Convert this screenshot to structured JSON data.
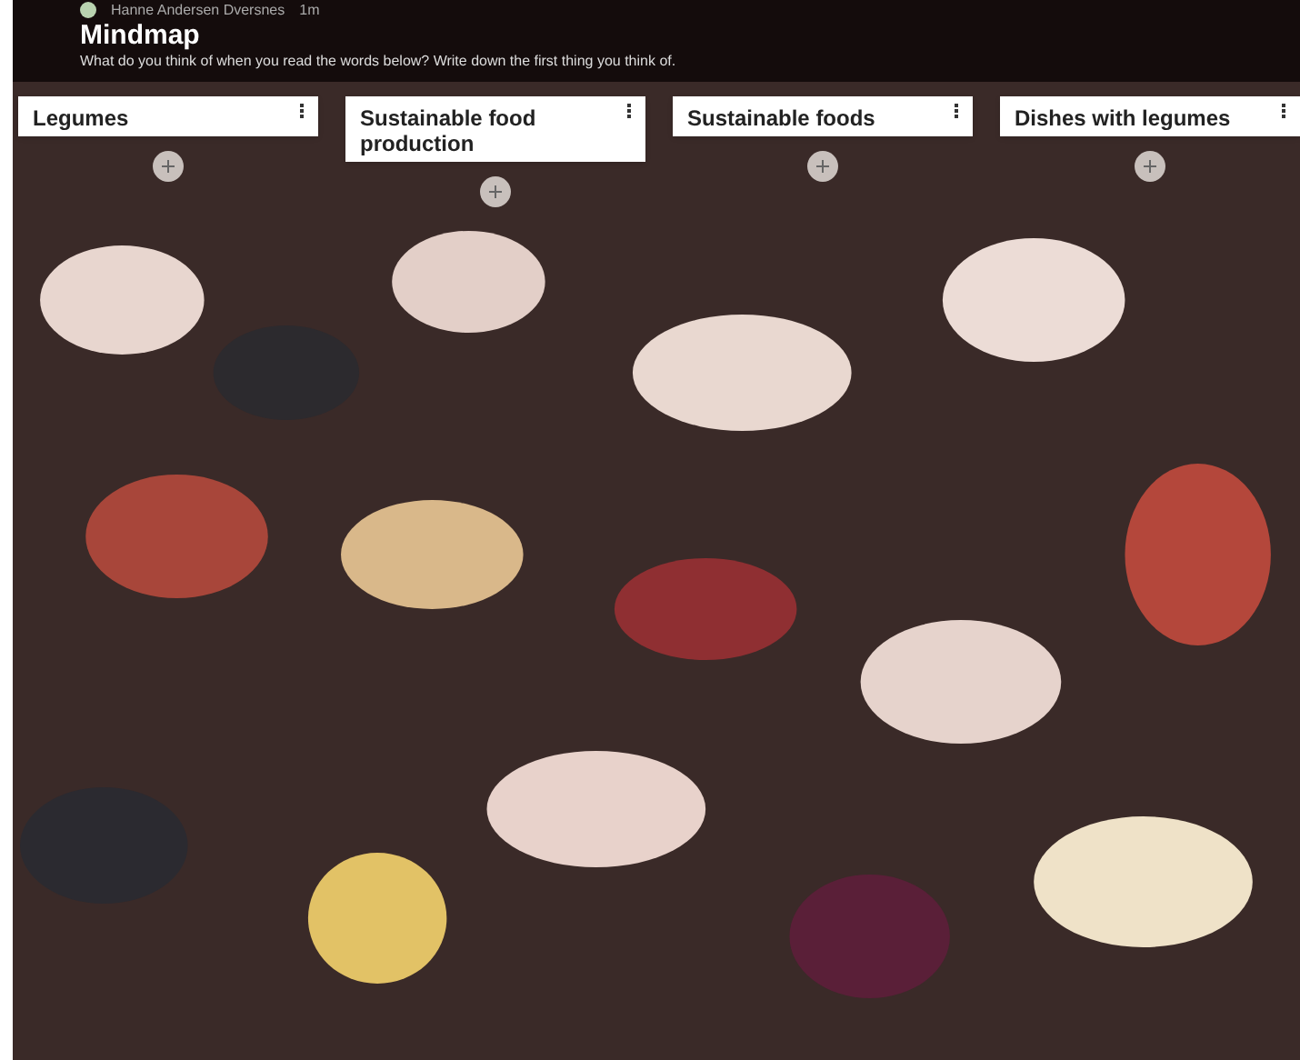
{
  "header": {
    "author": "Hanne Andersen Dversnes",
    "time": "1m",
    "title": "Mindmap",
    "prompt": "What do you think of when you read the words below? Write down the first thing you think of."
  },
  "columns": [
    {
      "title": "Legumes"
    },
    {
      "title": "Sustainable food production"
    },
    {
      "title": "Sustainable foods"
    },
    {
      "title": "Dishes with legumes"
    }
  ]
}
